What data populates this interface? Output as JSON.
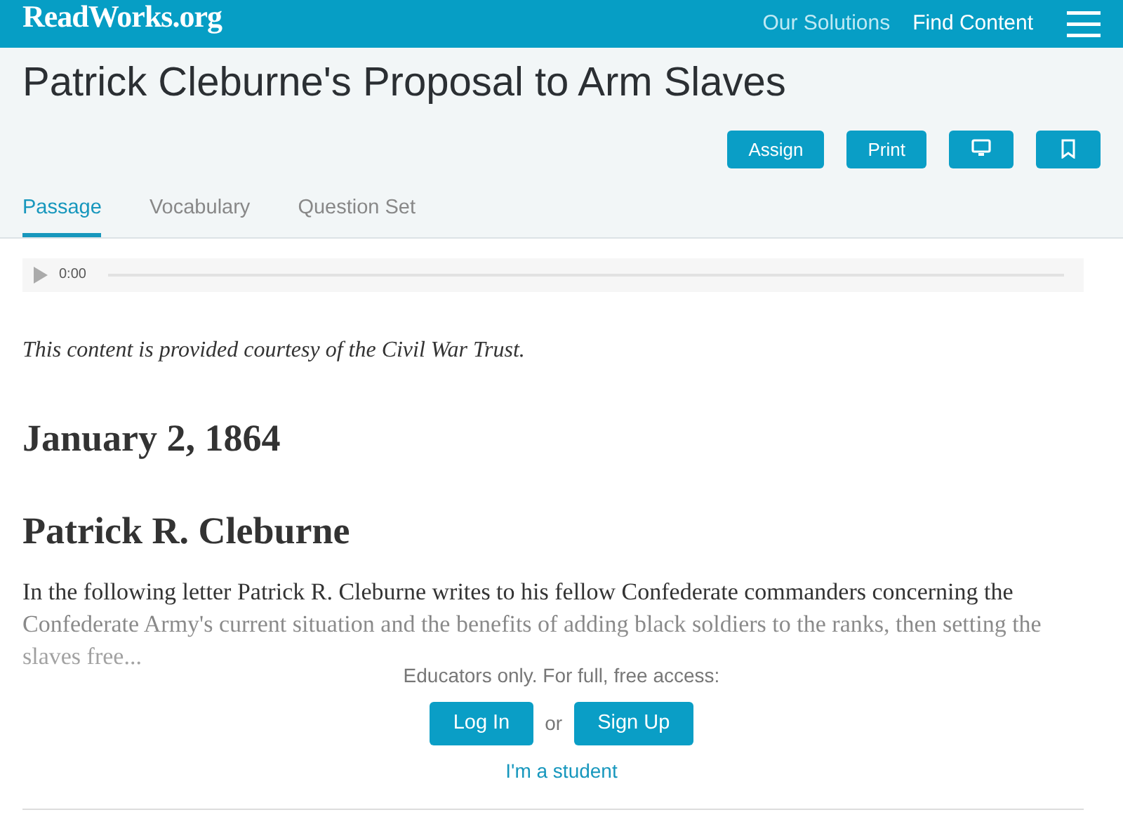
{
  "navbar": {
    "logo": "ReadWorks.org",
    "links": [
      {
        "label": "Our Solutions",
        "selected": false
      },
      {
        "label": "Find Content",
        "selected": true
      }
    ]
  },
  "title": "Patrick Cleburne's Proposal to Arm Slaves",
  "actions": [
    {
      "kind": "text",
      "label": "Assign"
    },
    {
      "kind": "text",
      "label": "Print"
    },
    {
      "kind": "monitor"
    },
    {
      "kind": "bookmark"
    }
  ],
  "tabs": [
    {
      "label": "Passage",
      "selected": true
    },
    {
      "label": "Vocabulary",
      "selected": false
    },
    {
      "label": "Question Set",
      "selected": false
    }
  ],
  "audio": {
    "time": "0:00"
  },
  "credit": "This content is provided courtesy of the Civil War Trust.",
  "date": "January 2, 1864",
  "author": "Patrick R. Cleburne",
  "summary": "In the following letter Patrick R. Cleburne writes to his fellow Confederate commanders concerning the Confederate Army's current situation and the benefits of adding black soldiers to the ranks, then setting the slaves free...",
  "access": {
    "prompt": "Educators only. For full, free access:",
    "login": "Log In",
    "or": "or",
    "signup": "Sign Up",
    "student": "I'm a student"
  }
}
